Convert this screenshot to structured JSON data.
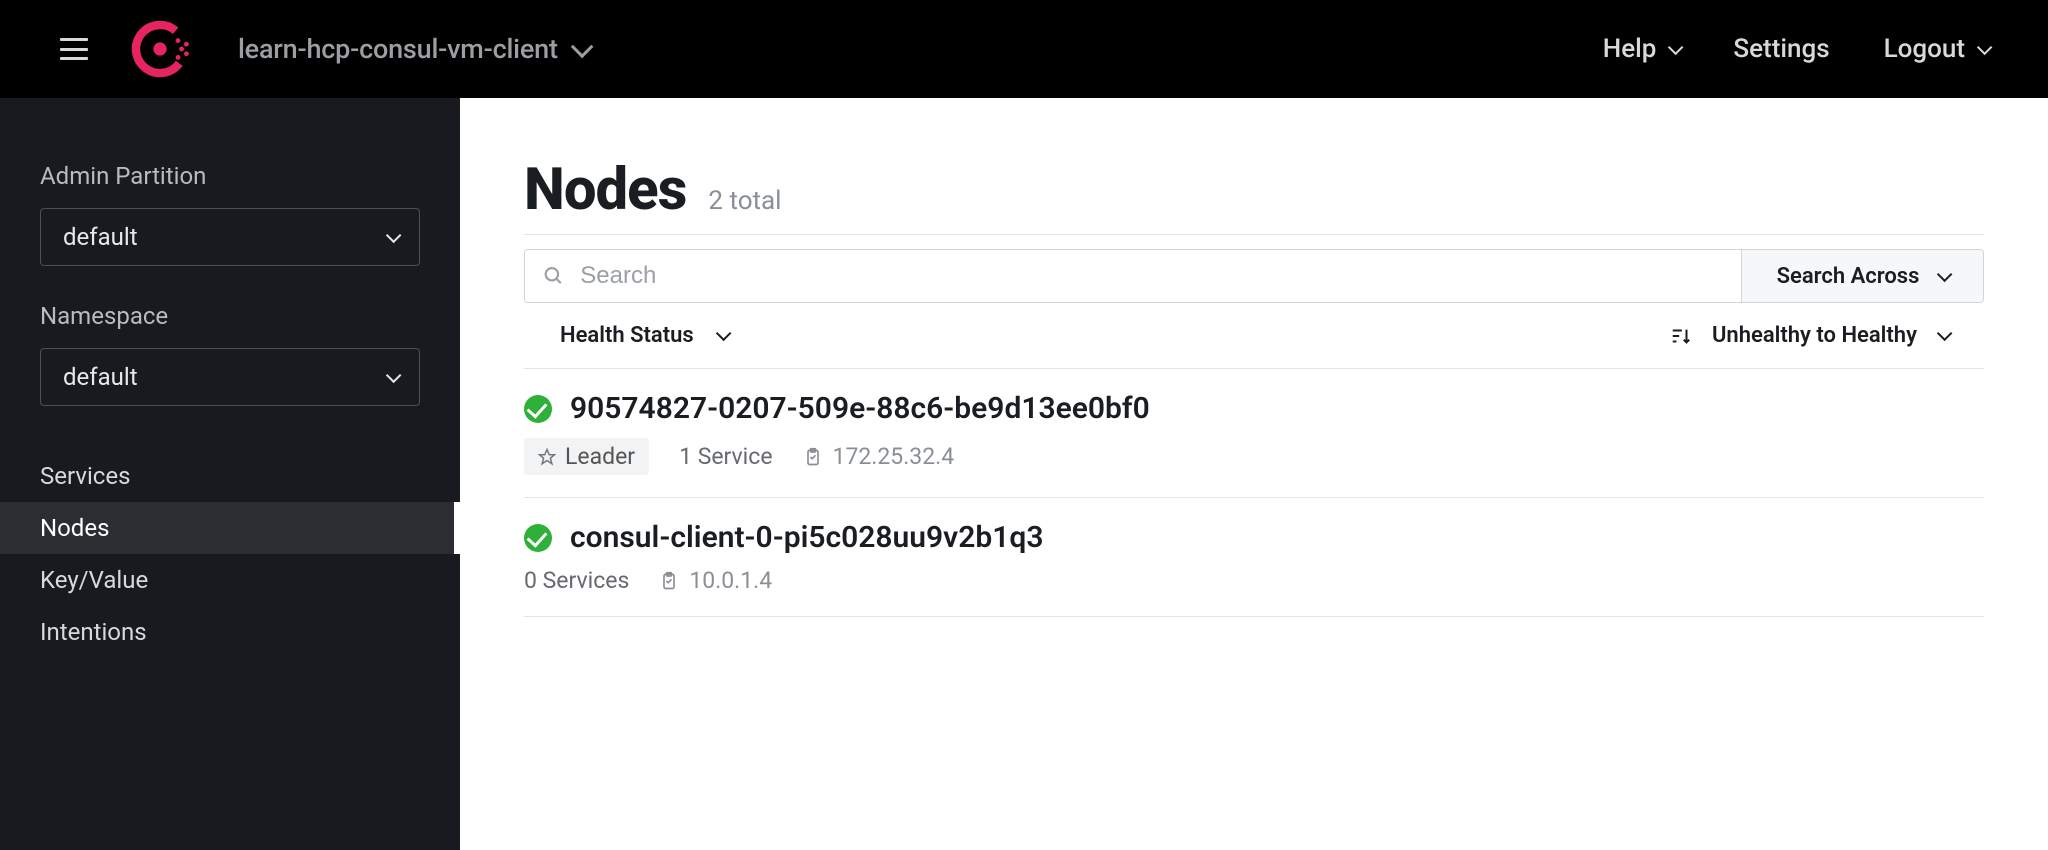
{
  "header": {
    "cluster_name": "learn-hcp-consul-vm-client",
    "links": {
      "help": "Help",
      "settings": "Settings",
      "logout": "Logout"
    }
  },
  "sidebar": {
    "admin_partition": {
      "label": "Admin Partition",
      "value": "default"
    },
    "namespace": {
      "label": "Namespace",
      "value": "default"
    },
    "nav": {
      "services": "Services",
      "nodes": "Nodes",
      "kv": "Key/Value",
      "intentions": "Intentions"
    }
  },
  "page": {
    "title": "Nodes",
    "total_text": "2 total",
    "search_placeholder": "Search",
    "search_across": "Search Across",
    "filter_label": "Health Status",
    "sort_label": "Unhealthy to Healthy"
  },
  "nodes": [
    {
      "name": "90574827-0207-509e-88c6-be9d13ee0bf0",
      "leader_badge": "Leader",
      "services_text": "1 Service",
      "ip": "172.25.32.4"
    },
    {
      "name": "consul-client-0-pi5c028uu9v2b1q3",
      "services_text": "0 Services",
      "ip": "10.0.1.4"
    }
  ]
}
